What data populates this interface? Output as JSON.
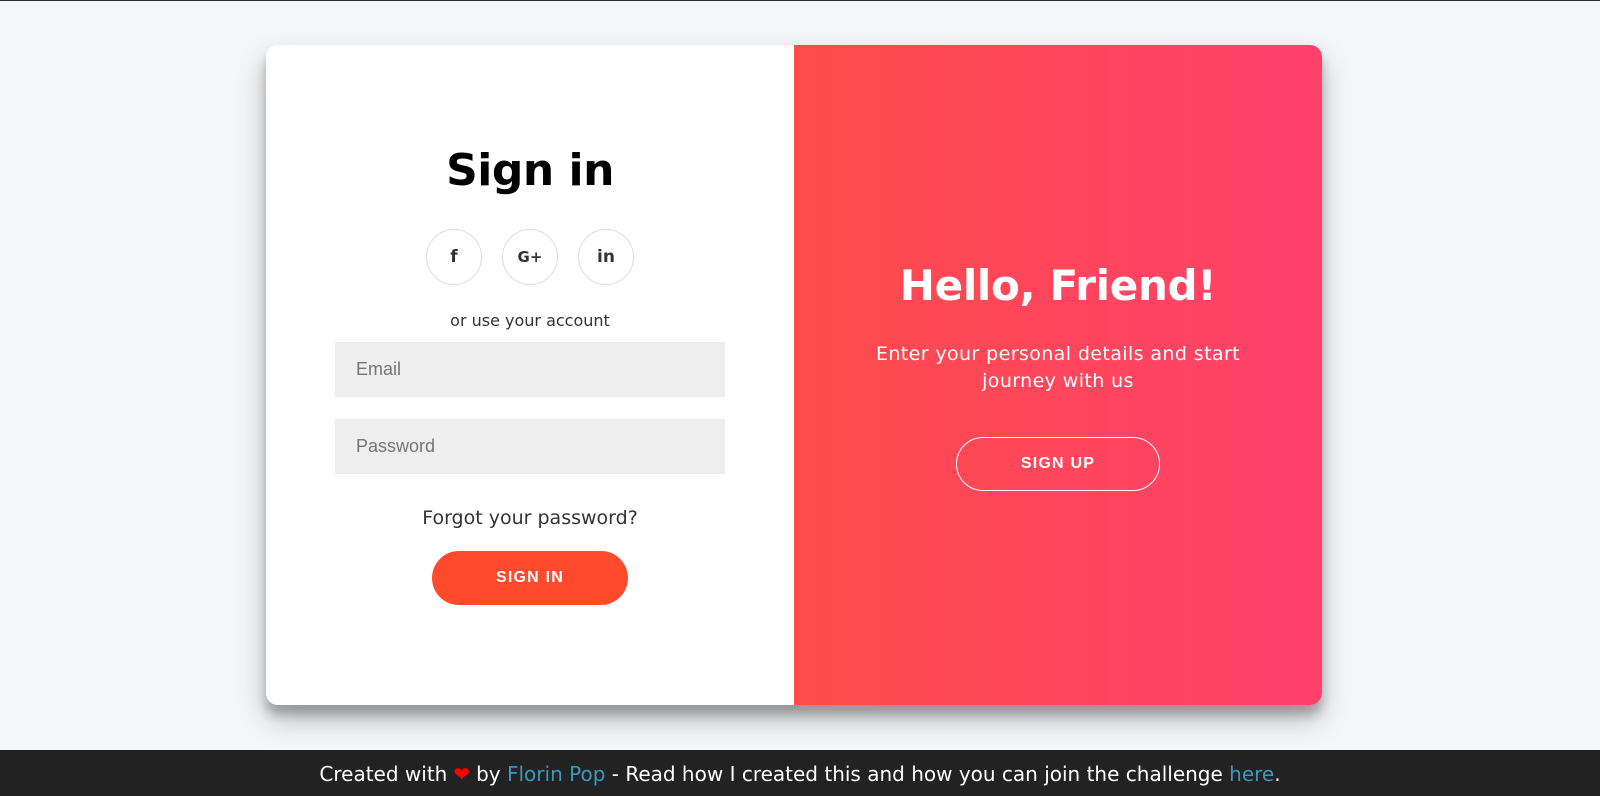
{
  "sign_in": {
    "title": "Sign in",
    "social": [
      {
        "name": "facebook",
        "glyph": "f"
      },
      {
        "name": "google-plus",
        "glyph": "G+"
      },
      {
        "name": "linkedin",
        "glyph": "in"
      }
    ],
    "or_text": "or use your account",
    "email_placeholder": "Email",
    "password_placeholder": "Password",
    "forgot_label": "Forgot your password?",
    "button_label": "SIGN IN"
  },
  "overlay": {
    "title": "Hello, Friend!",
    "text": "Enter your personal details and start journey with us",
    "button_label": "SIGN UP"
  },
  "footer": {
    "prefix": "Created with",
    "by_text": "by",
    "author_link": "Florin Pop",
    "middle_text": "- Read how I created this and how you can join the challenge",
    "here_link": "here",
    "suffix": "."
  },
  "colors": {
    "primary": "#ff4b2b",
    "gradient_start": "#ff4b4b",
    "gradient_end": "#ff416c",
    "link": "#3c97bf",
    "footer_bg": "#222222",
    "input_bg": "#eeeeee"
  }
}
